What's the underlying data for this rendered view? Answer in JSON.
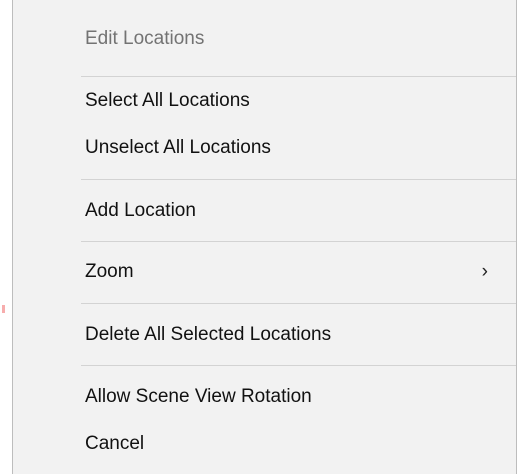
{
  "menu": {
    "header": "Edit Locations",
    "items": [
      {
        "label": "Select All Locations"
      },
      {
        "label": "Unselect All Locations"
      },
      {
        "label": "Add Location"
      },
      {
        "label": "Zoom",
        "submenu_indicator": "›"
      },
      {
        "label": "Delete All Selected Locations"
      },
      {
        "label": "Allow Scene View Rotation"
      },
      {
        "label": "Cancel"
      }
    ]
  }
}
